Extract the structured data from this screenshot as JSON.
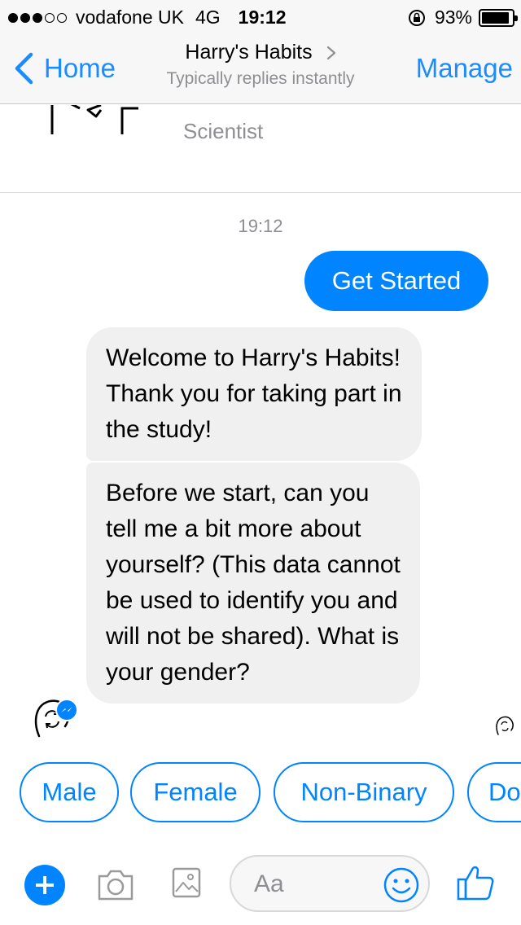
{
  "status_bar": {
    "carrier": "vodafone UK",
    "network": "4G",
    "time": "19:12",
    "battery": "93%",
    "battery_level": 0.93,
    "signal_bars": 3,
    "signal_bars_total": 5
  },
  "nav": {
    "back_label": "Home",
    "title": "Harry's Habits",
    "subtitle": "Typically replies instantly",
    "manage_label": "Manage"
  },
  "profile": {
    "role": "Scientist"
  },
  "chat": {
    "timestamp": "19:12",
    "outgoing": "Get Started",
    "incoming": [
      "Welcome to Harry's Habits! Thank you for taking part in the study!",
      "Before we start, can you tell me a bit more about yourself? (This data cannot be used to identify you and will not be shared). What is your gender?"
    ]
  },
  "quick_replies": [
    "Male",
    "Female",
    "Non-Binary",
    "Do"
  ],
  "composer": {
    "placeholder": "Aa"
  },
  "colors": {
    "accent": "#0084ff",
    "nav_blue": "#1a8cff",
    "incoming_bubble": "#f1f0f0",
    "muted_text": "#8e8e93"
  },
  "icons": {
    "back": "chevron-left-icon",
    "add": "plus-icon",
    "camera": "camera-icon",
    "gallery": "image-icon",
    "emoji": "smiley-icon",
    "like": "thumbs-up-icon"
  }
}
